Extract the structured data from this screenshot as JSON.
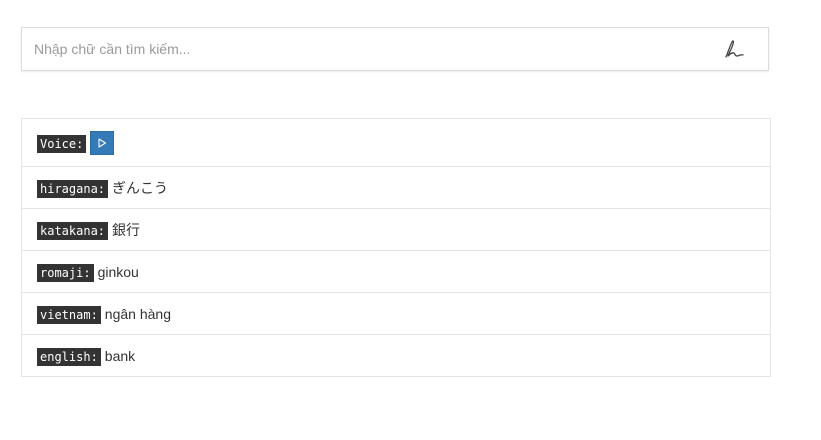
{
  "search": {
    "placeholder": "Nhập chữ cần tìm kiếm...",
    "value": "",
    "handwrite_icon": "handwriting-pen-icon"
  },
  "result": {
    "voice_label": "Voice:",
    "play_icon": "play-icon",
    "rows": [
      {
        "label": "hiragana:",
        "value": "ぎんこう"
      },
      {
        "label": "katakana:",
        "value": "銀行"
      },
      {
        "label": "romaji:",
        "value": "ginkou"
      },
      {
        "label": "vietnam:",
        "value": "ngân hàng"
      },
      {
        "label": "english:",
        "value": "bank"
      }
    ]
  },
  "colors": {
    "tag_bg": "#333333",
    "play_button": "#337ab7"
  }
}
